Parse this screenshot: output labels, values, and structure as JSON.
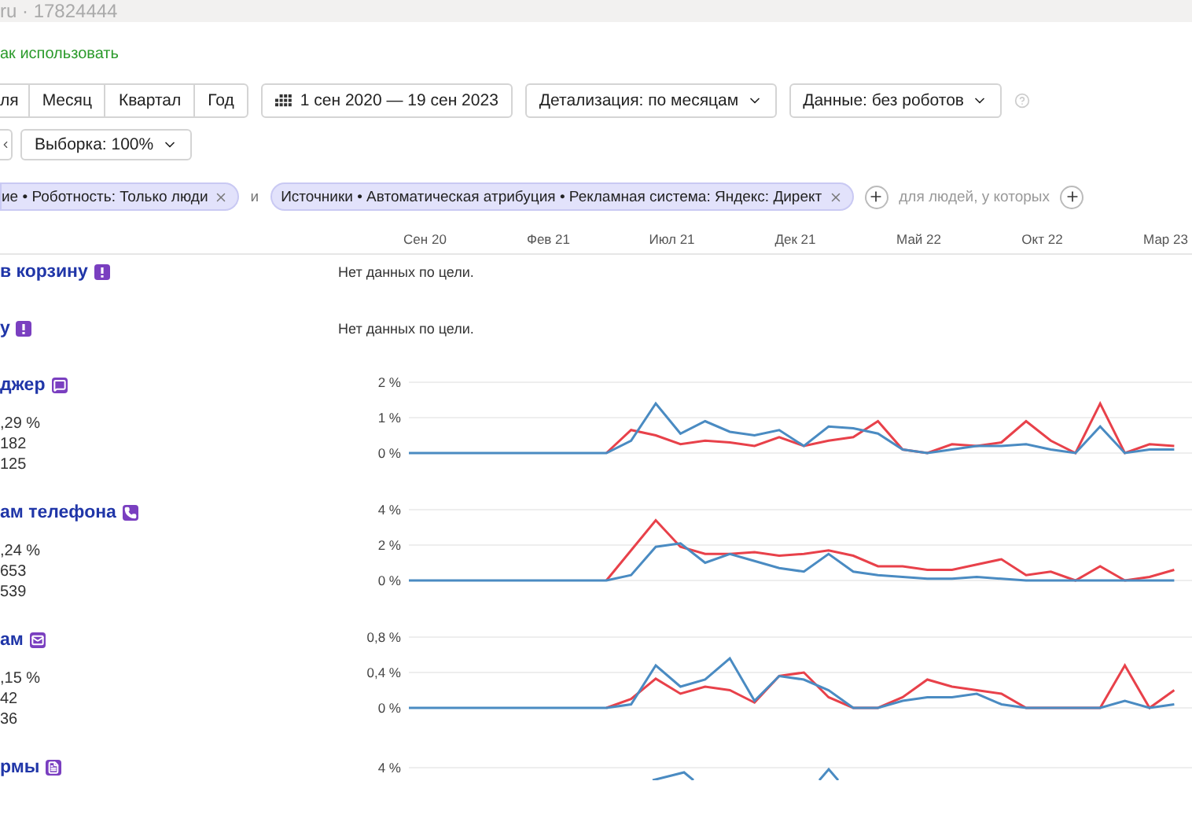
{
  "header": {
    "title": "ru · 17824444"
  },
  "help_link": "ак использовать",
  "period_tabs": [
    {
      "label": "ля",
      "selected": false
    },
    {
      "label": "Месяц",
      "selected": false
    },
    {
      "label": "Квартал",
      "selected": false
    },
    {
      "label": "Год",
      "selected": false
    }
  ],
  "date_range": "1 сен 2020 — 19 сен 2023",
  "dropdowns": [
    {
      "label": "Детализация: по месяцам"
    },
    {
      "label": "Данные: без роботов"
    }
  ],
  "sample": "Выборка: 100%",
  "filters": {
    "chips": [
      "ие • Роботность: Только люди",
      "Источники • Автоматическая атрибуция • Рекламная система: Яндекс: Директ"
    ],
    "joiner": "и",
    "people_hint": "для людей, у которых"
  },
  "timeline": [
    "Сен 20",
    "Фев 21",
    "Июл 21",
    "Дек 21",
    "Май 22",
    "Окт 22",
    "Мар 23"
  ],
  "goals": [
    {
      "kind": "empty",
      "title": "в корзину",
      "no_data": "Нет данных по цели."
    },
    {
      "kind": "empty",
      "title": "у",
      "no_data": "Нет данных по цели."
    },
    {
      "kind": "chart",
      "title": "джер",
      "metrics": [
        ",29 %",
        "182",
        "125"
      ],
      "chart_data": {
        "type": "line",
        "ylim": [
          0,
          2
        ],
        "yticks": [
          {
            "value": 0,
            "label": "0 %"
          },
          {
            "value": 1,
            "label": "1 %"
          },
          {
            "value": 2,
            "label": "2 %"
          }
        ],
        "series": [
          {
            "color": "#e8414a",
            "values": [
              null,
              null,
              null,
              null,
              null,
              null,
              null,
              null,
              0,
              0.65,
              0.5,
              0.25,
              0.35,
              0.3,
              0.2,
              0.45,
              0.2,
              0.35,
              0.45,
              0.9,
              0.1,
              0,
              0.25,
              0.2,
              0.3,
              0.9,
              0.35,
              0,
              1.4,
              0,
              0.25,
              0.2
            ]
          },
          {
            "color": "#4a8bc2",
            "values": [
              0,
              0,
              0,
              0,
              0,
              0,
              0,
              0,
              0,
              0.35,
              1.4,
              0.55,
              0.9,
              0.6,
              0.5,
              0.65,
              0.2,
              0.75,
              0.7,
              0.55,
              0.1,
              0,
              0.1,
              0.2,
              0.2,
              0.25,
              0.1,
              0,
              0.75,
              0,
              0.1,
              0.1
            ]
          }
        ]
      }
    },
    {
      "kind": "chart",
      "title": "ам телефона",
      "metrics": [
        ",24 %",
        "653",
        "539"
      ],
      "chart_data": {
        "type": "line",
        "ylim": [
          0,
          4
        ],
        "yticks": [
          {
            "value": 0,
            "label": "0 %"
          },
          {
            "value": 2,
            "label": "2 %"
          },
          {
            "value": 4,
            "label": "4 %"
          }
        ],
        "series": [
          {
            "color": "#e8414a",
            "values": [
              null,
              null,
              null,
              null,
              null,
              null,
              null,
              null,
              0,
              1.7,
              3.4,
              1.9,
              1.5,
              1.5,
              1.6,
              1.4,
              1.5,
              1.7,
              1.4,
              0.8,
              0.8,
              0.6,
              0.6,
              0.9,
              1.2,
              0.3,
              0.5,
              0,
              0.8,
              0,
              0.2,
              0.6
            ]
          },
          {
            "color": "#4a8bc2",
            "values": [
              0,
              0,
              0,
              0,
              0,
              0,
              0,
              0,
              0,
              0.3,
              1.9,
              2.1,
              1,
              1.5,
              1.1,
              0.7,
              0.5,
              1.5,
              0.5,
              0.3,
              0.2,
              0.1,
              0.1,
              0.2,
              0.1,
              0,
              0,
              0,
              0,
              0,
              0,
              0
            ]
          }
        ]
      }
    },
    {
      "kind": "chart",
      "title": "ам",
      "metrics": [
        ",15 %",
        "42",
        "36"
      ],
      "chart_data": {
        "type": "line",
        "ylim": [
          0,
          0.8
        ],
        "yticks": [
          {
            "value": 0,
            "label": "0 %"
          },
          {
            "value": 0.4,
            "label": "0,4 %"
          },
          {
            "value": 0.8,
            "label": "0,8 %"
          }
        ],
        "series": [
          {
            "color": "#e8414a",
            "values": [
              null,
              null,
              null,
              null,
              null,
              null,
              null,
              null,
              0,
              0.1,
              0.33,
              0.16,
              0.24,
              0.2,
              0.06,
              0.36,
              0.4,
              0.12,
              0,
              0,
              0.12,
              0.32,
              0.24,
              0.2,
              0.16,
              0,
              0,
              0,
              0,
              0.48,
              0,
              0.2
            ]
          },
          {
            "color": "#4a8bc2",
            "values": [
              0,
              0,
              0,
              0,
              0,
              0,
              0,
              0,
              0,
              0.04,
              0.48,
              0.24,
              0.32,
              0.56,
              0.08,
              0.36,
              0.32,
              0.2,
              0,
              0,
              0.08,
              0.12,
              0.12,
              0.16,
              0.04,
              0,
              0,
              0,
              0,
              0.08,
              0,
              0.04
            ]
          }
        ]
      }
    },
    {
      "kind": "cut",
      "title": "рмы",
      "top_tick": "4 %"
    }
  ]
}
